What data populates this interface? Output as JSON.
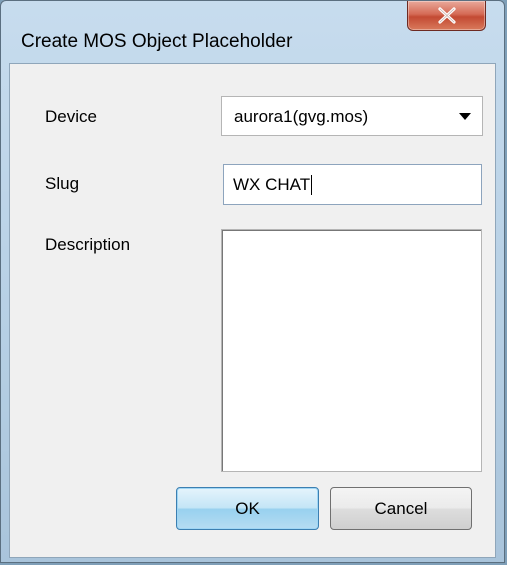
{
  "window": {
    "title": "Create MOS Object Placeholder"
  },
  "form": {
    "device_label": "Device",
    "device_value": "aurora1(gvg.mos)",
    "slug_label": "Slug",
    "slug_value": "WX CHAT",
    "description_label": "Description",
    "description_value": ""
  },
  "buttons": {
    "ok": "OK",
    "cancel": "Cancel"
  },
  "icons": {
    "close": "close-icon",
    "dropdown": "chevron-down-icon"
  },
  "colors": {
    "close_button": "#c34a33",
    "default_button_border": "#3c7fb1"
  }
}
